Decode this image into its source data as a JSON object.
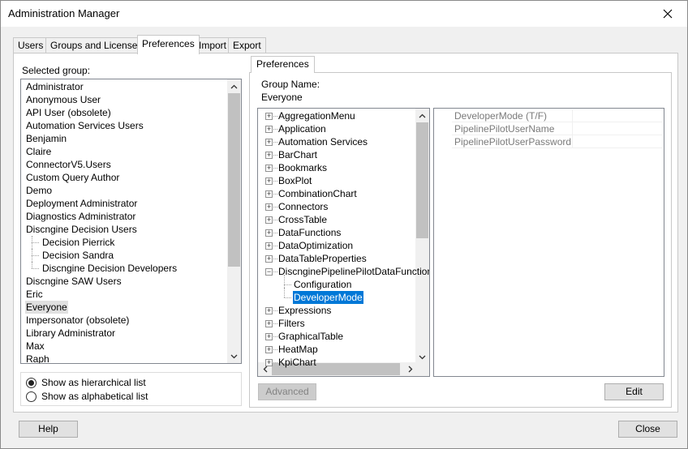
{
  "window": {
    "title": "Administration Manager"
  },
  "tabs": [
    {
      "label": "Users",
      "active": false
    },
    {
      "label": "Groups and Licenses",
      "active": false
    },
    {
      "label": "Preferences",
      "active": true
    },
    {
      "label": "Import",
      "active": false
    },
    {
      "label": "Export",
      "active": false
    }
  ],
  "groups_panel": {
    "label": "Selected group:",
    "items": [
      {
        "label": "Administrator",
        "indent": 0
      },
      {
        "label": "Anonymous User",
        "indent": 0
      },
      {
        "label": "API User (obsolete)",
        "indent": 0
      },
      {
        "label": "Automation Services Users",
        "indent": 0
      },
      {
        "label": "Benjamin",
        "indent": 0
      },
      {
        "label": "Claire",
        "indent": 0
      },
      {
        "label": "ConnectorV5.Users",
        "indent": 0
      },
      {
        "label": "Custom Query Author",
        "indent": 0
      },
      {
        "label": "Demo",
        "indent": 0
      },
      {
        "label": "Deployment Administrator",
        "indent": 0
      },
      {
        "label": "Diagnostics Administrator",
        "indent": 0
      },
      {
        "label": "Discngine Decision Users",
        "indent": 0
      },
      {
        "label": "Decision Pierrick",
        "indent": 1
      },
      {
        "label": "Decision Sandra",
        "indent": 1
      },
      {
        "label": "Discngine Decision Developers",
        "indent": 1
      },
      {
        "label": "Discngine SAW Users",
        "indent": 0
      },
      {
        "label": "Eric",
        "indent": 0
      },
      {
        "label": "Everyone",
        "indent": 0,
        "selected": true
      },
      {
        "label": "Impersonator (obsolete)",
        "indent": 0
      },
      {
        "label": "Library Administrator",
        "indent": 0
      },
      {
        "label": "Max",
        "indent": 0
      },
      {
        "label": "Raph",
        "indent": 0
      }
    ],
    "radio_hierarchical": "Show as hierarchical list",
    "radio_alphabetical": "Show as alphabetical list"
  },
  "preferences": {
    "tab_label": "Preferences",
    "group_name_label": "Group Name:",
    "group_name_value": "Everyone",
    "tree": [
      {
        "label": "AggregationMenu",
        "level": 0,
        "expander": "+"
      },
      {
        "label": "Application",
        "level": 0,
        "expander": "+"
      },
      {
        "label": "Automation Services",
        "level": 0,
        "expander": "+"
      },
      {
        "label": "BarChart",
        "level": 0,
        "expander": "+"
      },
      {
        "label": "Bookmarks",
        "level": 0,
        "expander": "+"
      },
      {
        "label": "BoxPlot",
        "level": 0,
        "expander": "+"
      },
      {
        "label": "CombinationChart",
        "level": 0,
        "expander": "+"
      },
      {
        "label": "Connectors",
        "level": 0,
        "expander": "+"
      },
      {
        "label": "CrossTable",
        "level": 0,
        "expander": "+"
      },
      {
        "label": "DataFunctions",
        "level": 0,
        "expander": "+"
      },
      {
        "label": "DataOptimization",
        "level": 0,
        "expander": "+"
      },
      {
        "label": "DataTableProperties",
        "level": 0,
        "expander": "+"
      },
      {
        "label": "DiscnginePipelinePilotDataFunction",
        "level": 0,
        "expander": "-"
      },
      {
        "label": "Configuration",
        "level": 1,
        "expander": ""
      },
      {
        "label": "DeveloperMode",
        "level": 1,
        "expander": "",
        "selected": true
      },
      {
        "label": "Expressions",
        "level": 0,
        "expander": "+"
      },
      {
        "label": "Filters",
        "level": 0,
        "expander": "+"
      },
      {
        "label": "GraphicalTable",
        "level": 0,
        "expander": "+"
      },
      {
        "label": "HeatMap",
        "level": 0,
        "expander": "+"
      },
      {
        "label": "KpiChart",
        "level": 0,
        "expander": "+"
      }
    ],
    "properties": [
      {
        "name": "DeveloperMode (T/F)",
        "value": ""
      },
      {
        "name": "PipelinePilotUserName",
        "value": ""
      },
      {
        "name": "PipelinePilotUserPassword",
        "value": ""
      }
    ],
    "advanced_label": "Advanced",
    "edit_label": "Edit"
  },
  "footer": {
    "help_label": "Help",
    "close_label": "Close"
  }
}
